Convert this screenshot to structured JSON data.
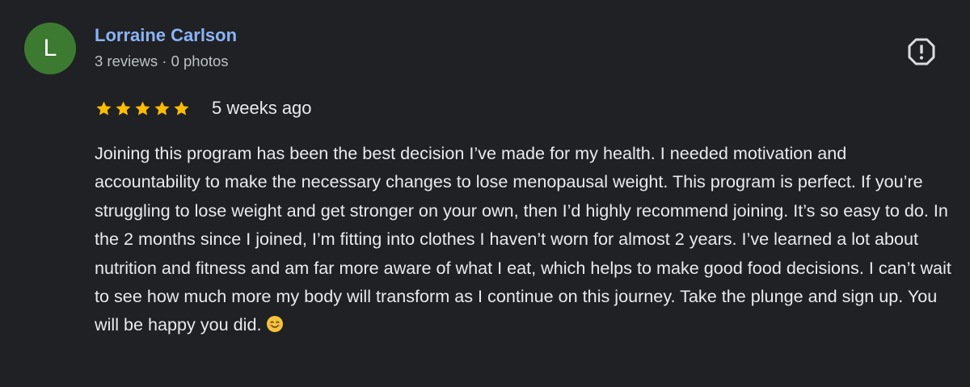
{
  "author": {
    "initial": "L",
    "name": "Lorraine Carlson",
    "meta": "3 reviews · 0 photos",
    "avatar_color": "#3c7a32",
    "name_color": "#8ab4f8"
  },
  "report_icon": "report-flag-icon",
  "rating": {
    "stars": 5,
    "max": 5,
    "star_color": "#fbbc04",
    "icon": "star-icon"
  },
  "timestamp": "5 weeks ago",
  "review_text": "Joining this program has been the best decision I’ve made for my health. I needed motivation and accountability to make the necessary changes to lose menopausal weight. This program is perfect. If you’re struggling to lose weight and get stronger on your own, then I’d highly recommend joining. It’s so easy to do. In the 2 months since I joined, I’m fitting into clothes I haven’t worn for almost 2 years. I’ve learned a lot about nutrition and fitness and am far more aware of what I eat, which helps to make good food decisions. I can’t wait to see how much more my body will transform as I continue on this journey. Take the plunge and sign up. You will be happy you did.",
  "trailing_emoji": "smiling-face-emoji"
}
